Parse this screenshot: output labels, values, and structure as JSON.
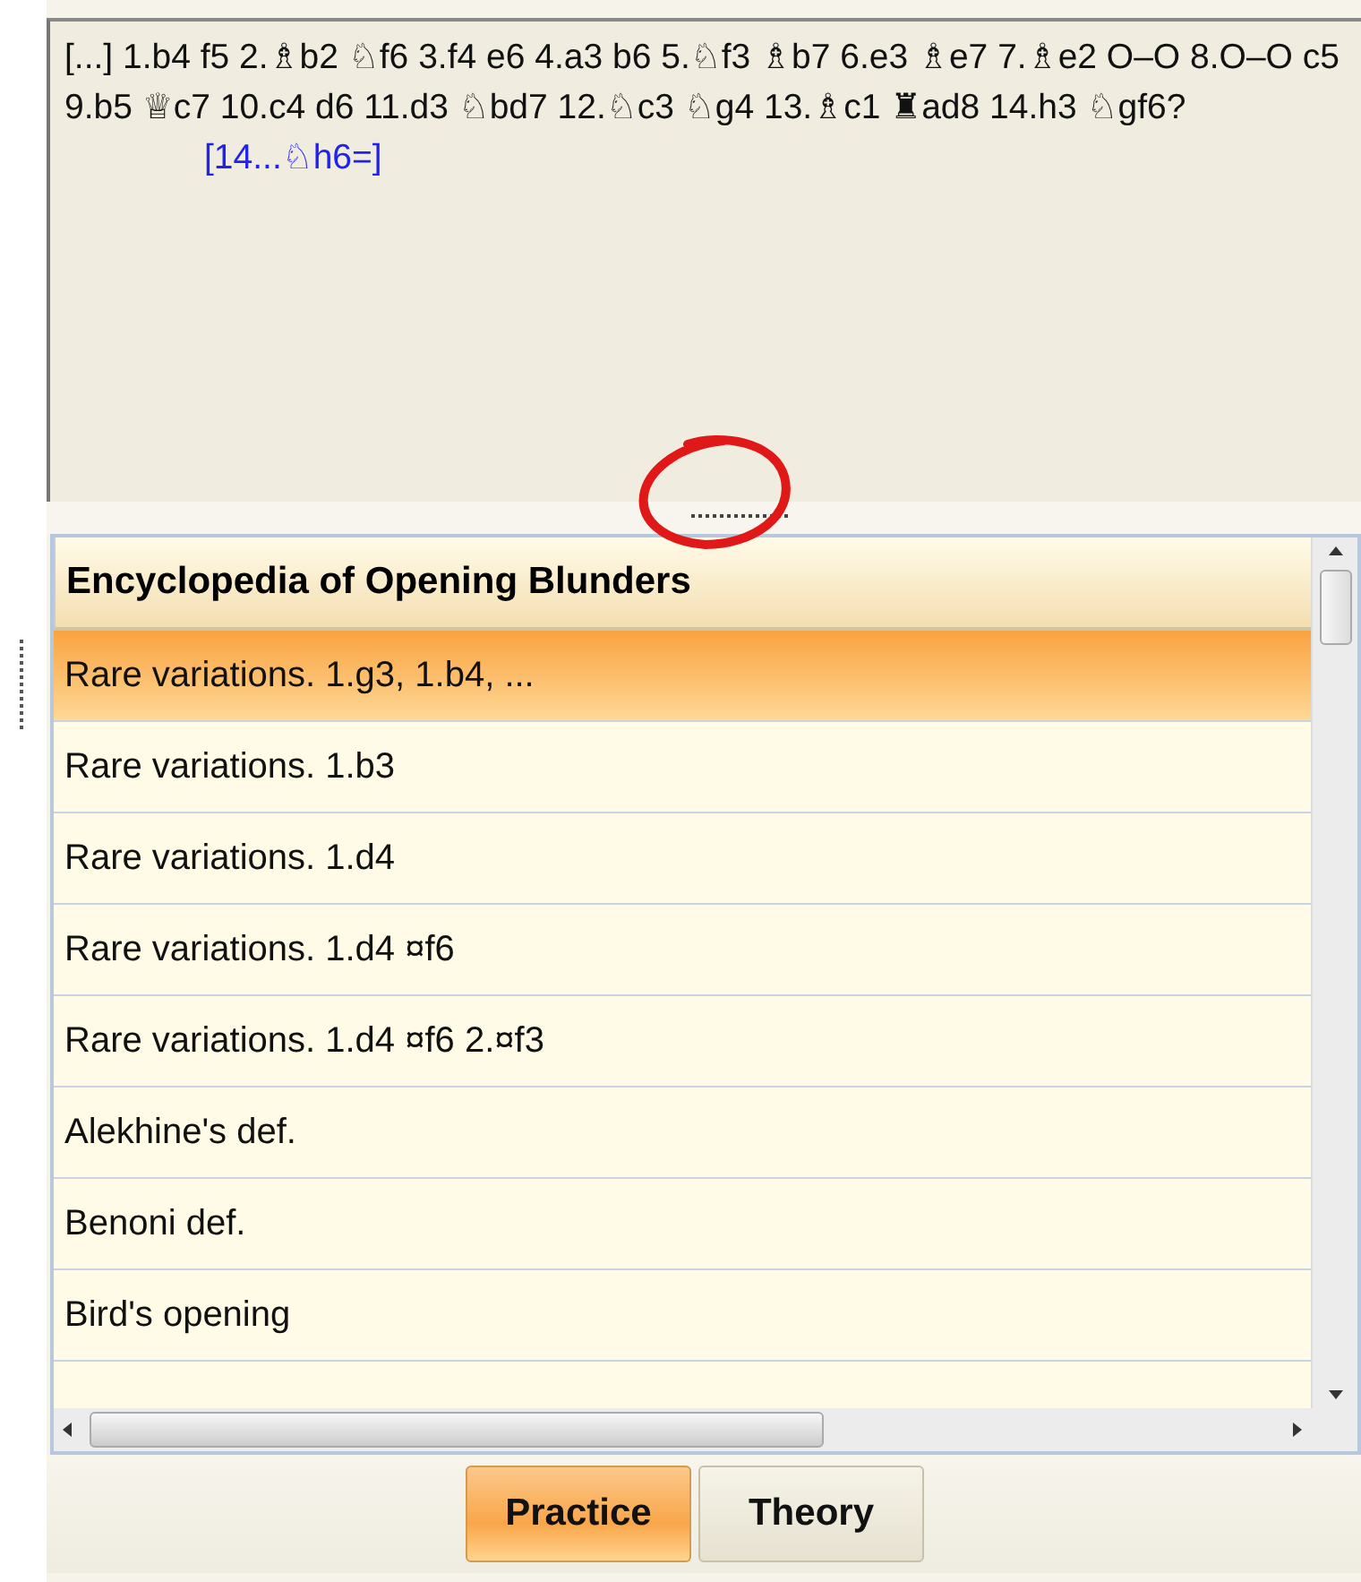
{
  "notation": {
    "moves": "[...] 1.b4 f5 2.♗b2 ♘f6 3.f4 e6 4.a3 b6 5.♘f3 ♗b7 6.e3 ♗e7 7.♗e2 O–O 8.O–O c5 9.b5 ♕c7 10.c4 d6 11.d3 ♘bd7 12.♘c3 ♘g4 13.♗c1 ♜ad8 14.h3 ♘gf6?",
    "variation": "[14...♘h6=]"
  },
  "list": {
    "heading": "Encyclopedia of Opening Blunders",
    "items": [
      {
        "label": "Rare variations. 1.g3, 1.b4, ...",
        "selected": true
      },
      {
        "label": "Rare variations. 1.b3",
        "selected": false
      },
      {
        "label": "Rare variations. 1.d4",
        "selected": false
      },
      {
        "label": "Rare variations. 1.d4 ¤f6",
        "selected": false
      },
      {
        "label": "Rare variations. 1.d4 ¤f6 2.¤f3",
        "selected": false
      },
      {
        "label": "Alekhine's def.",
        "selected": false
      },
      {
        "label": "Benoni def.",
        "selected": false
      },
      {
        "label": "Bird's opening",
        "selected": false
      }
    ]
  },
  "buttons": [
    {
      "label": "Practice",
      "selected": true
    },
    {
      "label": "Theory",
      "selected": false
    }
  ]
}
